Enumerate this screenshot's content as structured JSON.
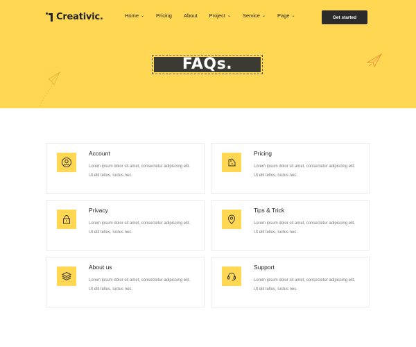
{
  "brand": {
    "name": "Creativic."
  },
  "nav": [
    {
      "label": "Home",
      "has_dropdown": true
    },
    {
      "label": "Pricing",
      "has_dropdown": false
    },
    {
      "label": "About",
      "has_dropdown": false
    },
    {
      "label": "Project",
      "has_dropdown": true
    },
    {
      "label": "Service",
      "has_dropdown": true
    },
    {
      "label": "Page",
      "has_dropdown": true
    }
  ],
  "cta": {
    "label": "Get started"
  },
  "hero": {
    "title": "FAQs."
  },
  "cards": [
    {
      "title": "Account",
      "icon": "user-icon",
      "body": "Lorem ipsum dolor sit amet, consectetur adipiscing elit. Ut elit tellus, luctus nec."
    },
    {
      "title": "Pricing",
      "icon": "price-tag-icon",
      "body": "Lorem ipsum dolor sit amet, consectetur adipiscing elit. Ut elit tellus, luctus nec."
    },
    {
      "title": "Privacy",
      "icon": "lock-icon",
      "body": "Lorem ipsum dolor sit amet, consectetur adipiscing elit. Ut elit tellus, luctus nec."
    },
    {
      "title": "Tips & Trick",
      "icon": "map-pin-icon",
      "body": "Lorem ipsum dolor sit amet, consectetur adipiscing elit. Ut elit tellus, luctus nec."
    },
    {
      "title": "About us",
      "icon": "layers-icon",
      "body": "Lorem ipsum dolor sit amet, consectetur adipiscing elit. Ut elit tellus, luctus nec."
    },
    {
      "title": "Support",
      "icon": "headset-icon",
      "body": "Lorem ipsum dolor sit amet, consectetur adipiscing elit. Ut elit tellus, luctus nec."
    }
  ],
  "colors": {
    "accent": "#ffd753",
    "dark": "#2b2b2b",
    "body_text": "#777777"
  }
}
